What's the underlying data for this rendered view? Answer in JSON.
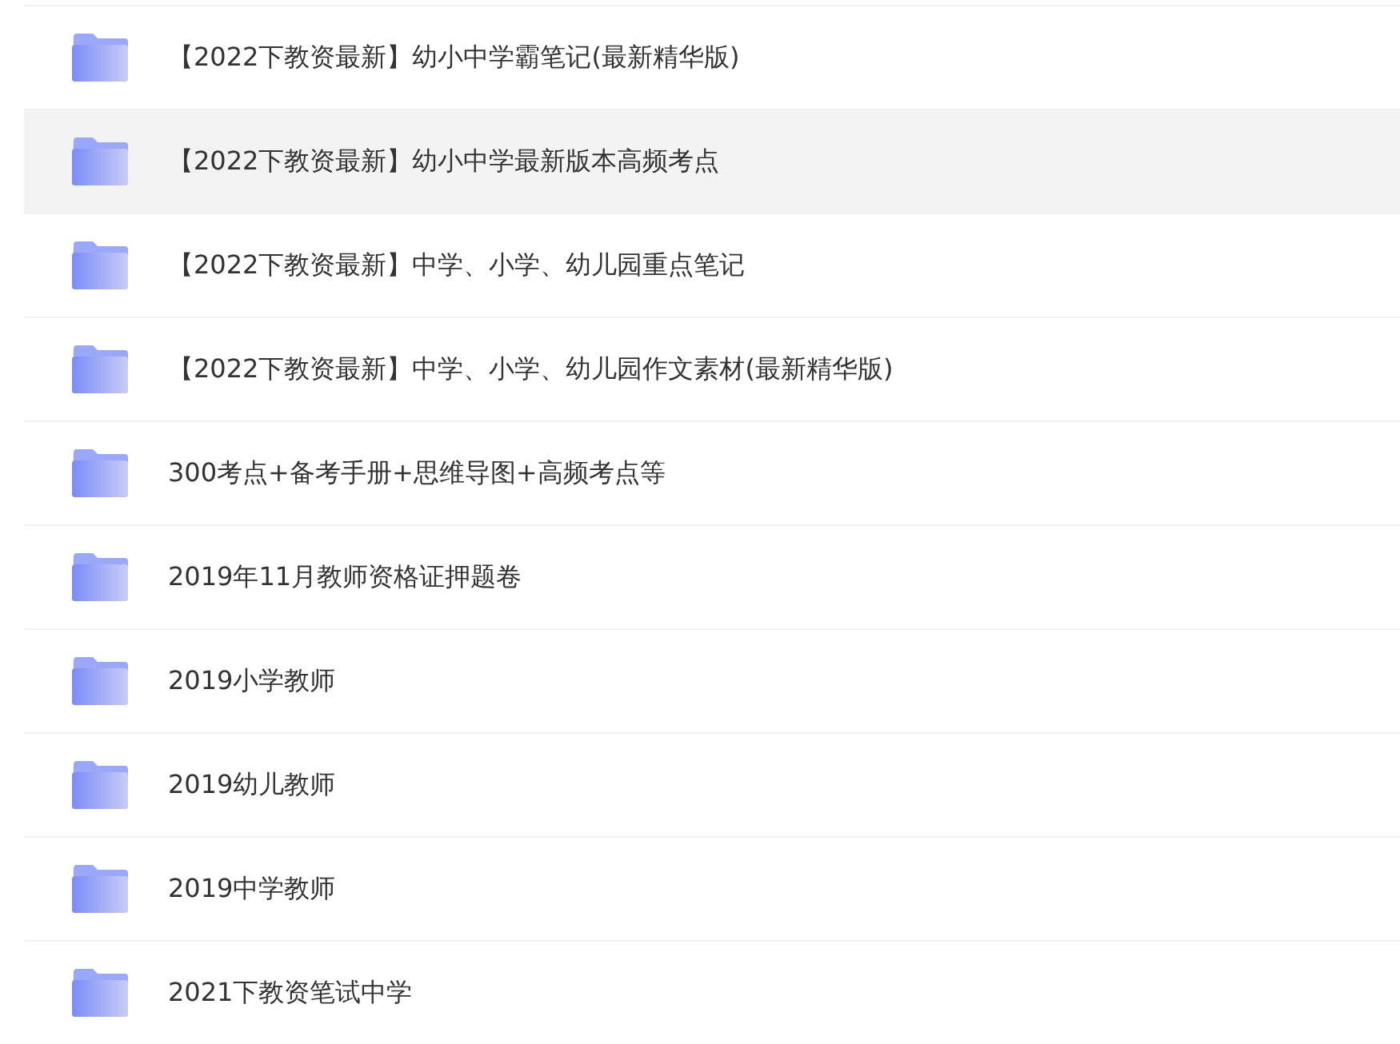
{
  "files": [
    {
      "name": "【2022下教资最新】幼小中学霸笔记(最新精华版)",
      "selected": false
    },
    {
      "name": "【2022下教资最新】幼小中学最新版本高频考点",
      "selected": true
    },
    {
      "name": "【2022下教资最新】中学、小学、幼儿园重点笔记",
      "selected": false
    },
    {
      "name": "【2022下教资最新】中学、小学、幼儿园作文素材(最新精华版)",
      "selected": false
    },
    {
      "name": "300考点+备考手册+思维导图+高频考点等",
      "selected": false
    },
    {
      "name": "2019年11月教师资格证押题卷",
      "selected": false
    },
    {
      "name": "2019小学教师",
      "selected": false
    },
    {
      "name": "2019幼儿教师",
      "selected": false
    },
    {
      "name": "2019中学教师",
      "selected": false
    },
    {
      "name": "2021下教资笔试中学",
      "selected": false
    }
  ]
}
